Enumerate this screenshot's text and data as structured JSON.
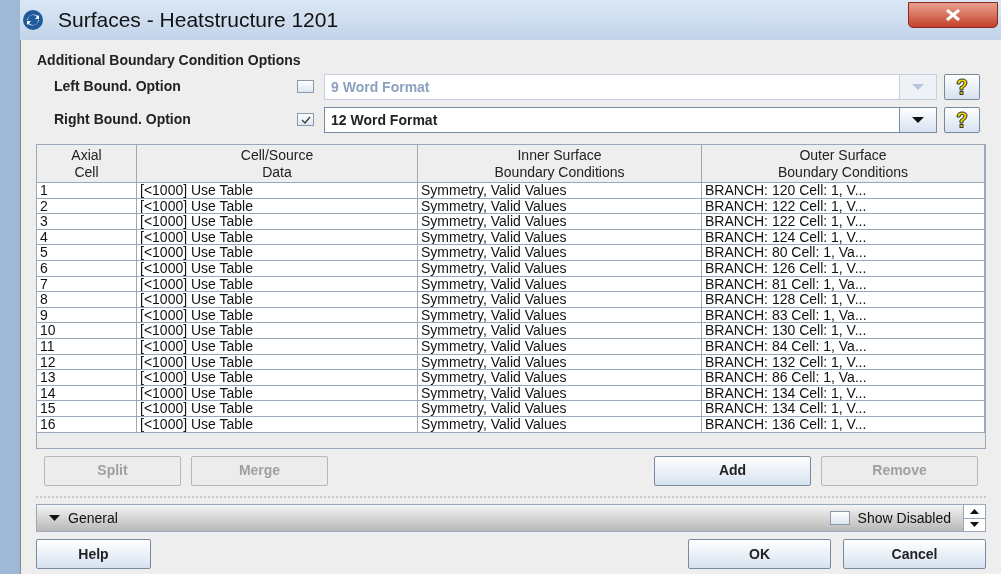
{
  "window": {
    "title": "Surfaces - Heatstructure 1201"
  },
  "section_title": "Additional Boundary Condition Options",
  "options": [
    {
      "label": "Left Bound. Option",
      "checked": false,
      "value": "9 Word Format",
      "disabled": true
    },
    {
      "label": "Right Bound. Option",
      "checked": true,
      "value": "12 Word Format",
      "disabled": false
    }
  ],
  "table": {
    "columns": [
      "Axial\nCell",
      "Cell/Source\nData",
      "Inner Surface\nBoundary Conditions",
      "Outer Surface\nBoundary Conditions"
    ],
    "rows": [
      [
        "1",
        "[<1000] Use Table",
        "Symmetry, Valid Values",
        "BRANCH: 120 Cell: 1, V..."
      ],
      [
        "2",
        "[<1000] Use Table",
        "Symmetry, Valid Values",
        "BRANCH: 122 Cell: 1, V..."
      ],
      [
        "3",
        "[<1000] Use Table",
        "Symmetry, Valid Values",
        "BRANCH: 122 Cell: 1, V..."
      ],
      [
        "4",
        "[<1000] Use Table",
        "Symmetry, Valid Values",
        "BRANCH: 124 Cell: 1, V..."
      ],
      [
        "5",
        "[<1000] Use Table",
        "Symmetry, Valid Values",
        "BRANCH: 80 Cell: 1, Va..."
      ],
      [
        "6",
        "[<1000] Use Table",
        "Symmetry, Valid Values",
        "BRANCH: 126 Cell: 1, V..."
      ],
      [
        "7",
        "[<1000] Use Table",
        "Symmetry, Valid Values",
        "BRANCH: 81 Cell: 1, Va..."
      ],
      [
        "8",
        "[<1000] Use Table",
        "Symmetry, Valid Values",
        "BRANCH: 128 Cell: 1, V..."
      ],
      [
        "9",
        "[<1000] Use Table",
        "Symmetry, Valid Values",
        "BRANCH: 83 Cell: 1, Va..."
      ],
      [
        "10",
        "[<1000] Use Table",
        "Symmetry, Valid Values",
        "BRANCH: 130 Cell: 1, V..."
      ],
      [
        "11",
        "[<1000] Use Table",
        "Symmetry, Valid Values",
        "BRANCH: 84 Cell: 1, Va..."
      ],
      [
        "12",
        "[<1000] Use Table",
        "Symmetry, Valid Values",
        "BRANCH: 132 Cell: 1, V..."
      ],
      [
        "13",
        "[<1000] Use Table",
        "Symmetry, Valid Values",
        "BRANCH: 86 Cell: 1, Va..."
      ],
      [
        "14",
        "[<1000] Use Table",
        "Symmetry, Valid Values",
        "BRANCH: 134 Cell: 1, V..."
      ],
      [
        "15",
        "[<1000] Use Table",
        "Symmetry, Valid Values",
        "BRANCH: 134 Cell: 1, V..."
      ],
      [
        "16",
        "[<1000] Use Table",
        "Symmetry, Valid Values",
        "BRANCH: 136 Cell: 1, V..."
      ]
    ]
  },
  "table_buttons": [
    {
      "label": "Split",
      "disabled": true
    },
    {
      "label": "Merge",
      "disabled": true
    },
    {
      "label": "Add",
      "disabled": false
    },
    {
      "label": "Remove",
      "disabled": true
    }
  ],
  "general_bar": {
    "label": "General",
    "show_disabled": {
      "label": "Show Disabled",
      "checked": false
    }
  },
  "footer_buttons": [
    {
      "label": "Help"
    },
    {
      "label": "OK"
    },
    {
      "label": "Cancel"
    }
  ]
}
